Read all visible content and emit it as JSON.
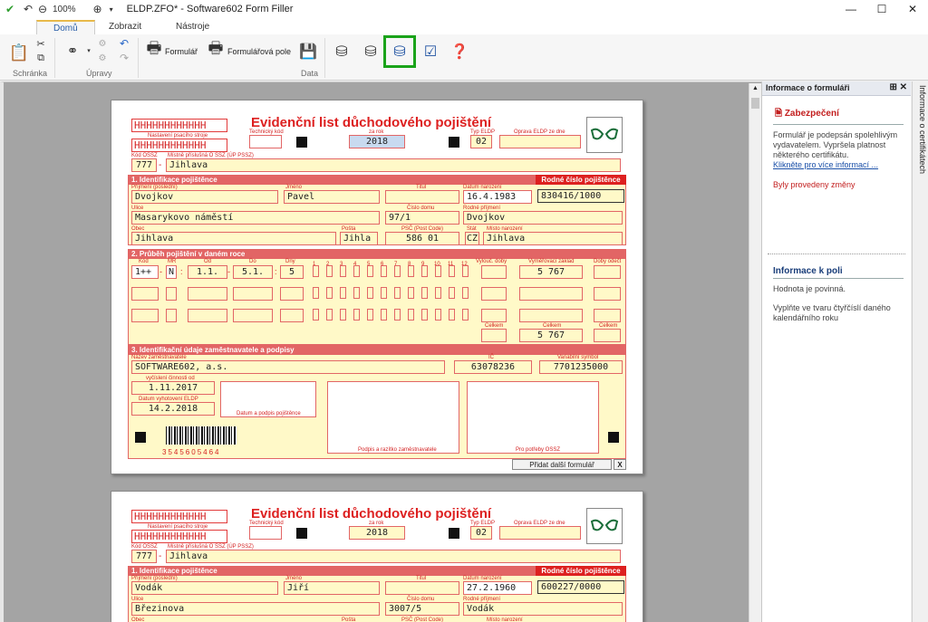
{
  "titlebar": {
    "zoom": "100%",
    "title": "ELDP.ZFO* - Software602 Form Filler"
  },
  "tabs": [
    "Domů",
    "Zobrazit",
    "Nástroje"
  ],
  "ribbon": {
    "groups": [
      "Schránka",
      "Úpravy",
      "Data"
    ],
    "formular_label": "Formulář",
    "formularova_pole_label": "Formulářová pole"
  },
  "panel": {
    "header": "Informace o formuláři",
    "security_title": "Zabezpečení",
    "security_text": "Formulář je podepsán spolehlivým vydavatelem. Vypršela platnost některého certifikátu.",
    "security_link": "Klikněte pro více informací ...",
    "changes_text": "Byly provedeny změny",
    "field_info_title": "Informace k poli",
    "field_required": "Hodnota je povinná.",
    "field_hint": "Vyplňte ve tvaru čtyřčíslí daného kalendářního roku",
    "side_tab": "Informace o certifikátech"
  },
  "form": {
    "hbox": "HHHHHHHHHHHH",
    "title": "Evidenční list důchodového pojištění",
    "label_nastaveni": "Nastavení psacího stroje",
    "label_techkod": "Technický kód",
    "label_zarok": "za rok",
    "label_typ": "Typ ELDP",
    "label_oprava": "Oprava ELDP ze dne",
    "label_kodossz": "Kód OSSZ",
    "label_mistni": "Místně příslušná O SSZ (ÚP PSSZ)",
    "sect1": "1. Identifikace pojištěnce",
    "rc_label": "Rodné číslo pojištěnce",
    "label_prijmeni": "Příjmení (poslední)",
    "label_jmeno": "Jméno",
    "label_titul": "Titul",
    "label_datum_nar": "Datum narození",
    "label_ulice": "Ulice",
    "label_cislo_domu": "Číslo domu",
    "label_rodne_prijmeni": "Rodné příjmení",
    "label_obec": "Obec",
    "label_posta": "Pošta",
    "label_psc": "PSČ (Post Code)",
    "label_stat": "Stát",
    "label_misto_nar": "Místo narození",
    "sect2": "2. Průběh pojištění v daném roce",
    "label_kod": "Kód",
    "label_mr": "MR",
    "label_od": "Od",
    "label_do": "Do",
    "label_dny": "Dny",
    "months": [
      "1",
      "2",
      "3",
      "4",
      "5",
      "6",
      "7",
      "8",
      "9",
      "10",
      "11",
      "12"
    ],
    "label_vylouc": "Vylouč. doby",
    "label_vymer": "Vyměřovací základ",
    "label_doby": "Doby odečt",
    "label_celkem": "Celkem",
    "sect3": "3. Identifikační údaje zaměstnavatele a podpisy",
    "label_nazev": "Název zaměstnavatele",
    "label_ic": "IČ",
    "label_varsym": "Variabilní symbol",
    "label_vyc": "vyčíslení činnosti od",
    "label_vyhot": "Datum vyhotovení ELDP",
    "label_datum_podpis": "Datum a podpis pojištěnce",
    "label_razitko": "Podpis a razítko zaměstnavatele",
    "label_pro_potreby": "Pro potřeby OSSZ",
    "barcode_num": "3545605464",
    "add_btn": "Přidat další formulář",
    "add_x": "X"
  },
  "page1": {
    "rok": "2018",
    "typ": "02",
    "kod_ossz": "777",
    "mistni": "Jihlava",
    "prijmeni": "Dvojkov",
    "jmeno": "Pavel",
    "datum_nar": "16.4.1983",
    "rodne_cislo": "830416/1000",
    "ulice": "Masarykovo náměstí",
    "cislo_domu": "97/1",
    "rodne_prijmeni": "Dvojkov",
    "obec": "Jihlava",
    "posta": "Jihla",
    "psc": "586 01",
    "stat": "CZ",
    "misto_nar": "Jihlava",
    "row1_kod": "1++",
    "row1_mr": "N",
    "row1_od": "1.1.",
    "row1_do": "5.1.",
    "row1_dny": "5",
    "row1_vymer": "5 767",
    "celkem_vymer": "5 767",
    "zamestnavatel": "SOFTWARE602, a.s.",
    "ic": "63078236",
    "varsym": "7701235000",
    "vyc_od": "1.11.2017",
    "vyhot": "14.2.2018"
  },
  "page2": {
    "rok": "2018",
    "typ": "02",
    "kod_ossz": "777",
    "mistni": "Jihlava",
    "prijmeni": "Vodák",
    "jmeno": "Jiří",
    "datum_nar": "27.2.1960",
    "rodne_cislo": "600227/0000",
    "ulice": "Březinova",
    "cislo_domu": "3007/5",
    "rodne_prijmeni": "Vodák"
  },
  "colors": {
    "form_red": "#dd2020",
    "field_yellow": "#fff9c8",
    "active_green": "#1aa31a"
  }
}
